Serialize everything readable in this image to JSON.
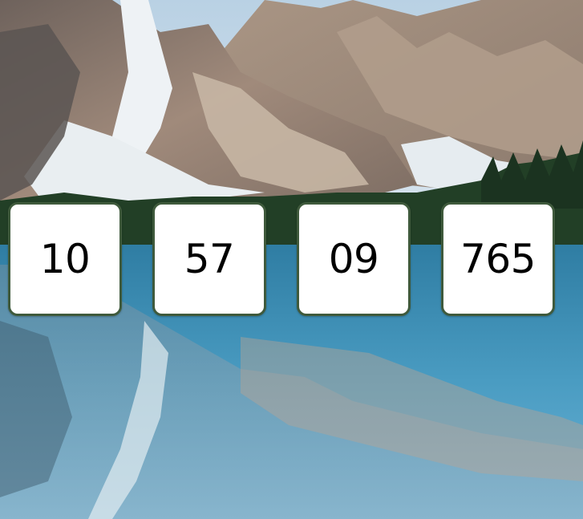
{
  "background": {
    "icon": "mountain-lake-background",
    "colors": {
      "sky": "#c9dcea",
      "rock": "#9a8476",
      "snow": "#eef2f5",
      "forest": "#1f3a22",
      "water": "#3d8fb4"
    }
  },
  "tiles": [
    {
      "value": "10"
    },
    {
      "value": "57"
    },
    {
      "value": "09"
    },
    {
      "value": "765"
    }
  ],
  "colors": {
    "tile_background": "#ffffff",
    "tile_border": "#3f5a3c",
    "tile_text": "#000000"
  }
}
